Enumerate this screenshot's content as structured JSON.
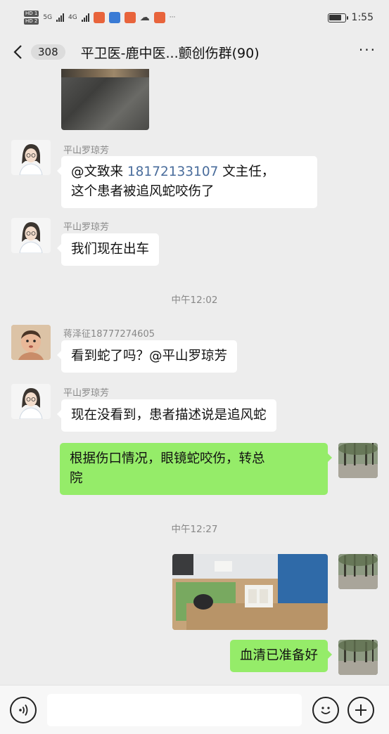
{
  "status_bar": {
    "hd1": "HD 1",
    "hd2": "HD 2",
    "net1": "5G",
    "net2": "4G",
    "more": "···",
    "time": "1:55",
    "battery_level": 0.8
  },
  "header": {
    "unread_count": "308",
    "title": "平卫医-鹿中医...颤创伤群(90)",
    "more": "···"
  },
  "messages": [
    {
      "sender": "平山罗琼芳",
      "mention": "@文致来 ",
      "phone": "18172133107",
      "text_after": " 文主任，",
      "line2": "这个患者被追风蛇咬伤了"
    },
    {
      "sender": "平山罗琼芳",
      "text": "我们现在出车"
    },
    {
      "time": "中午12:02"
    },
    {
      "sender": "蒋泽征18777274605",
      "text": "看到蛇了吗？@平山罗琼芳"
    },
    {
      "sender": "平山罗琼芳",
      "text": "现在没看到，患者描述说是追风蛇"
    },
    {
      "text_line1": "根据伤口情况，眼镜蛇咬伤，转总",
      "text_line2": "院"
    },
    {
      "time": "中午12:27"
    },
    {
      "text": "血清已准备好"
    }
  ],
  "input_bar": {
    "placeholder": ""
  }
}
